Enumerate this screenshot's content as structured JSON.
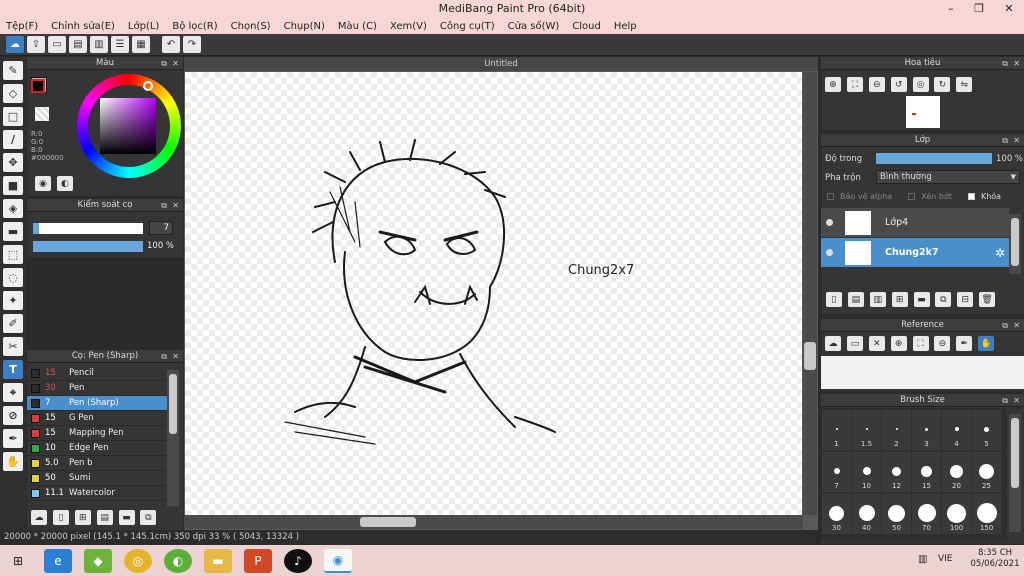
{
  "window": {
    "title": "MediBang Paint Pro (64bit)",
    "min": "–",
    "max": "❐",
    "close": "✕"
  },
  "menu": [
    "Tệp(F)",
    "Chỉnh sửa(E)",
    "Lớp(L)",
    "Bộ lọc(R)",
    "Chọn(S)",
    "Chụp(N)",
    "Màu (C)",
    "Xem(V)",
    "Công cụ(T)",
    "Cửa số(W)",
    "Cloud",
    "Help"
  ],
  "color_panel": {
    "title": "Màu",
    "r": "R:0",
    "g": "G:0",
    "b": "B:0",
    "hex": "#000000",
    "fg": "#000000",
    "bg": "#b8b8b8"
  },
  "brush_control": {
    "title": "Kiểm soát cọ",
    "size": "7",
    "size_fraction": 0.05,
    "opacity": "100 %",
    "opacity_fraction": 1.0
  },
  "brush_list": {
    "title": "Cọ: Pen (Sharp)",
    "items": [
      {
        "size": "15",
        "name": "Pencil",
        "color": "#2c2c2c",
        "sizecolor": "#e05050"
      },
      {
        "size": "30",
        "name": "Pen",
        "color": "#2c2c2c",
        "sizecolor": "#e05050"
      },
      {
        "size": "7",
        "name": "Pen (Sharp)",
        "color": "#2c2c2c",
        "sizecolor": "#e05050"
      },
      {
        "size": "15",
        "name": "G Pen",
        "color": "#e43a3a",
        "sizecolor": "#ffffff"
      },
      {
        "size": "15",
        "name": "Mapping Pen",
        "color": "#e43a3a",
        "sizecolor": "#ffffff"
      },
      {
        "size": "10",
        "name": "Edge Pen",
        "color": "#2fae3a",
        "sizecolor": "#ffffff"
      },
      {
        "size": "5.0",
        "name": "Pen b",
        "color": "#e8d23a",
        "sizecolor": "#ffffff"
      },
      {
        "size": "50",
        "name": "Sumi",
        "color": "#e8d23a",
        "sizecolor": "#ffffff"
      },
      {
        "size": "11.1",
        "name": "Watercolor",
        "color": "#7ec8ee",
        "sizecolor": "#ffffff"
      }
    ]
  },
  "canvas": {
    "tab": "Untitled",
    "watermark": "Chung2x7"
  },
  "status": {
    "text": "20000 * 20000 pixel  (145.1 * 145.1cm)  350 dpi  33 %  ( 5043, 13324 )"
  },
  "navigator": {
    "title": "Hoa tiêu"
  },
  "layers": {
    "title": "Lớp",
    "opacity_label": "Độ trong",
    "opacity_value": "100 %",
    "opacity_fraction": 1.0,
    "blend_label": "Pha trộn",
    "blend_value": "Bình thường",
    "protect_alpha": "Bảo vệ alpha",
    "clipping": "Xén bớt",
    "lock": "Khóa",
    "items": [
      {
        "name": "Lớp4"
      },
      {
        "name": "Chung2k7"
      }
    ]
  },
  "reference": {
    "title": "Reference"
  },
  "brush_size": {
    "title": "Brush Size",
    "sizes": [
      "1",
      "1.5",
      "2",
      "3",
      "4",
      "5",
      "7",
      "10",
      "12",
      "15",
      "20",
      "25",
      "30",
      "40",
      "50",
      "70",
      "100",
      "150"
    ]
  },
  "taskbar": {
    "lang": "VIE",
    "time": "8:35 CH",
    "date": "05/06/2021"
  }
}
